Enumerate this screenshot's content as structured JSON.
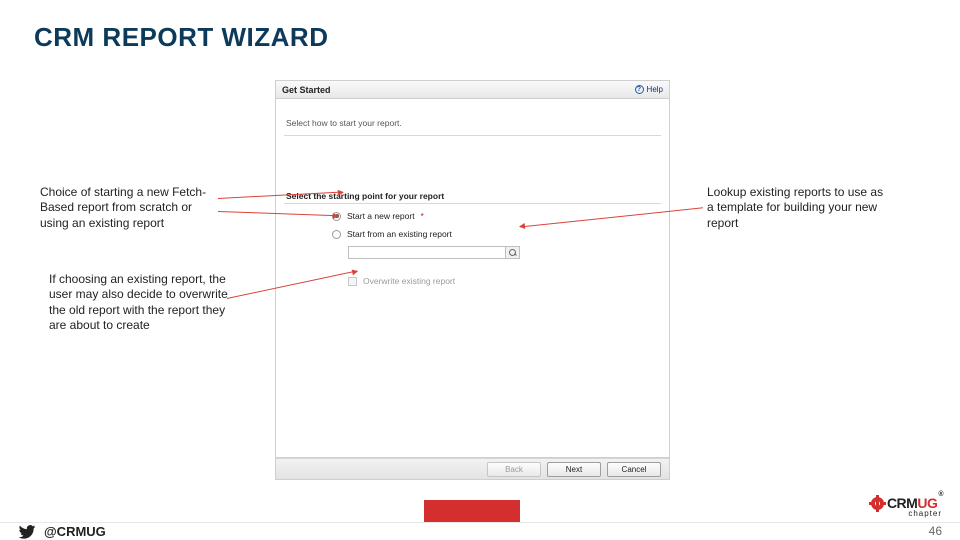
{
  "slide_title": "CRM REPORT WIZARD",
  "dialog": {
    "title": "Get Started",
    "help": "Help",
    "instruction": "Select how to start your report.",
    "section": "Select the starting point for your report",
    "opt_new": "Start a new report",
    "opt_existing": "Start from an existing report",
    "overwrite": "Overwrite existing report",
    "back": "Back",
    "next": "Next",
    "cancel": "Cancel"
  },
  "callouts": {
    "left_top": "Choice of starting a new Fetch-Based report from scratch or using an existing report",
    "left_bottom": "If choosing an existing report, the user may also decide to overwrite the old report with the report they are about to create",
    "right": "Lookup existing reports to use as a template for building your new report"
  },
  "footer": {
    "handle": "@CRMUG",
    "page": "46",
    "logo_crm": "CRM",
    "logo_ug": "UG",
    "chapter": "chapter"
  }
}
